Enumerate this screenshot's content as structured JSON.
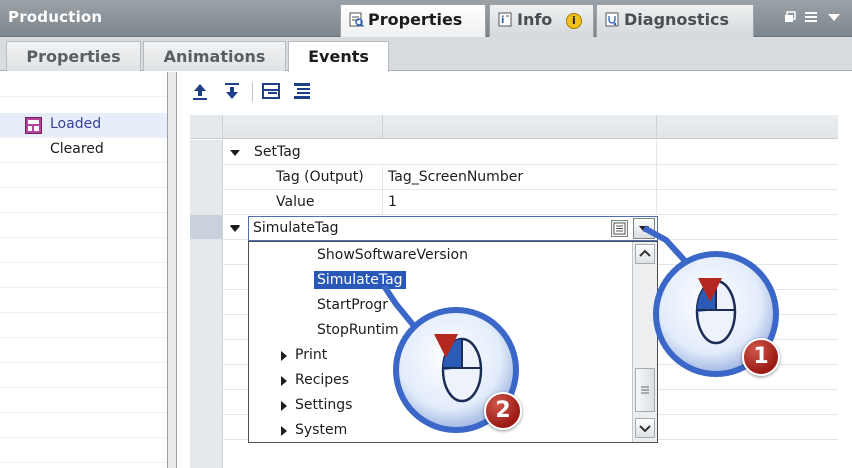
{
  "window": {
    "title": "Production",
    "tabs": [
      {
        "label": "Properties",
        "icon": "properties-icon",
        "active": true
      },
      {
        "label": "Info",
        "icon": "info-icon",
        "active": false
      },
      {
        "label": "Diagnostics",
        "icon": "diagnostics-icon",
        "active": false
      }
    ],
    "info_badge": "i",
    "controls": [
      "restore-icon",
      "list-icon",
      "dropdown-arrow-icon"
    ]
  },
  "subtabs": [
    {
      "label": "Properties",
      "active": false
    },
    {
      "label": "Animations",
      "active": false
    },
    {
      "label": "Events",
      "active": true
    }
  ],
  "events": [
    {
      "label": "Loaded",
      "selected": true,
      "icon": "event-icon"
    },
    {
      "label": "Cleared",
      "selected": false
    }
  ],
  "toolbar": {
    "buttons": [
      "move-up-icon",
      "move-down-icon",
      "collapse-all-icon",
      "expand-all-icon"
    ]
  },
  "function_list": {
    "settag": {
      "name": "SetTag",
      "params": [
        {
          "name": "Tag (Output)",
          "value": "Tag_ScreenNumber"
        },
        {
          "name": "Value",
          "value": "1"
        }
      ]
    },
    "combo": {
      "value": "SimulateTag"
    },
    "dropdown": {
      "items": [
        {
          "label": "ShowSoftwareVersion",
          "selected": false
        },
        {
          "label": "SimulateTag",
          "selected": true
        },
        {
          "label": "StartProgr",
          "selected": false
        },
        {
          "label": "StopRuntim",
          "selected": false
        }
      ],
      "groups": [
        "Print",
        "Recipes",
        "Settings",
        "System"
      ]
    }
  },
  "callouts": [
    {
      "number": "1",
      "icon": "mouse-left-click-icon"
    },
    {
      "number": "2",
      "icon": "mouse-left-click-icon"
    }
  ],
  "colors": {
    "selection": "#2a58b9",
    "badge": "#b5281f",
    "callout_blue": "#3a67c8"
  }
}
